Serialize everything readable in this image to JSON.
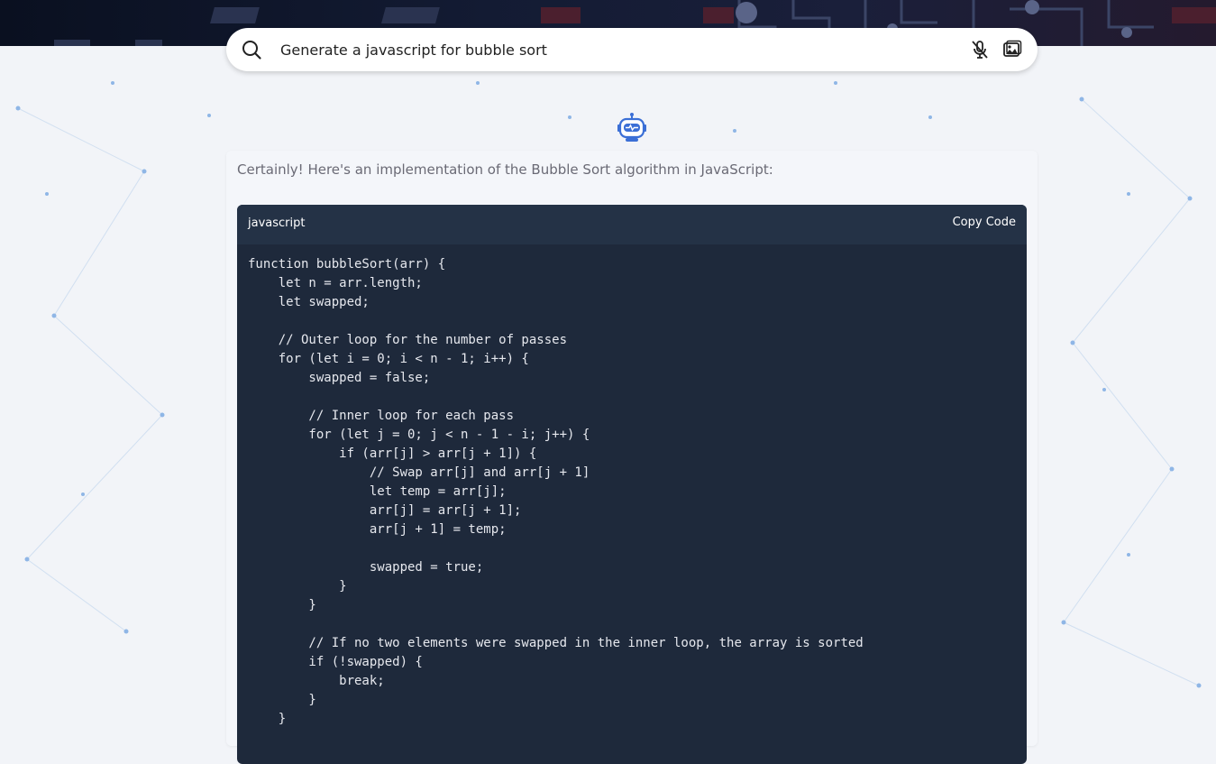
{
  "search": {
    "query": "Generate a javascript for bubble sort",
    "icons": {
      "search": "search-icon",
      "mic": "mic-off-icon",
      "image": "image-search-icon"
    }
  },
  "assistant": {
    "icon": "robot-icon"
  },
  "answer": {
    "intro": "Certainly! Here's an implementation of the Bubble Sort algorithm in JavaScript:",
    "code_block": {
      "language": "javascript",
      "copy_label": "Copy Code",
      "lines": [
        "function bubbleSort(arr) {",
        "    let n = arr.length;",
        "    let swapped;",
        "",
        "    // Outer loop for the number of passes",
        "    for (let i = 0; i < n - 1; i++) {",
        "        swapped = false;",
        "",
        "        // Inner loop for each pass",
        "        for (let j = 0; j < n - 1 - i; j++) {",
        "            if (arr[j] > arr[j + 1]) {",
        "                // Swap arr[j] and arr[j + 1]",
        "                let temp = arr[j];",
        "                arr[j] = arr[j + 1];",
        "                arr[j + 1] = temp;",
        "",
        "                swapped = true;",
        "            }",
        "        }",
        "",
        "        // If no two elements were swapped in the inner loop, the array is sorted",
        "        if (!swapped) {",
        "            break;",
        "        }",
        "    }"
      ]
    }
  },
  "colors": {
    "background": "#f2f4f8",
    "banner": "#131b33",
    "code_bg": "#1e293b",
    "code_header": "#243246",
    "robot_accent": "#3b6fd6"
  }
}
